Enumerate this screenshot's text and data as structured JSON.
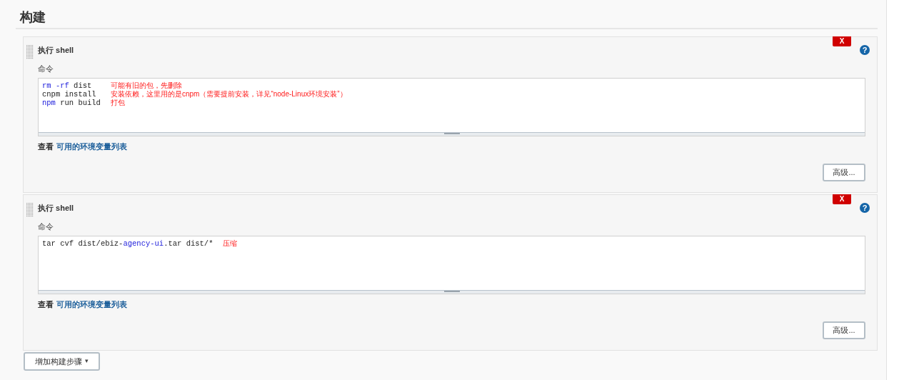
{
  "section_title": "构建",
  "steps": [
    {
      "title": "执行 shell",
      "delete_label": "X",
      "help_label": "?",
      "field_label": "命令",
      "lines": [
        {
          "code": [
            {
              "text": "rm -rf",
              "kind": "keyword"
            },
            {
              "text": " dist",
              "kind": "plain"
            }
          ],
          "note": "可能有旧的包，先删除"
        },
        {
          "code": [
            {
              "text": "cnpm install",
              "kind": "plain"
            }
          ],
          "note": "安装依赖，这里用的是cnpm（需要提前安装，详见“node-Linux环境安装”）"
        },
        {
          "code": [
            {
              "text": "npm",
              "kind": "keyword"
            },
            {
              "text": " run build",
              "kind": "plain"
            }
          ],
          "note": "打包"
        }
      ],
      "env_prefix": "查看",
      "env_link": "可用的环境变量列表",
      "advanced_label": "高级..."
    },
    {
      "title": "执行 shell",
      "delete_label": "X",
      "help_label": "?",
      "field_label": "命令",
      "lines": [
        {
          "code": [
            {
              "text": "tar cvf dist/ebiz-",
              "kind": "plain"
            },
            {
              "text": "agency-ui",
              "kind": "keyword"
            },
            {
              "text": ".tar dist/*",
              "kind": "plain"
            }
          ],
          "note": "压缩"
        }
      ],
      "env_prefix": "查看",
      "env_link": "可用的环境变量列表",
      "advanced_label": "高级..."
    }
  ],
  "add_step_label": "增加构建步骤",
  "add_step_caret": "▾"
}
